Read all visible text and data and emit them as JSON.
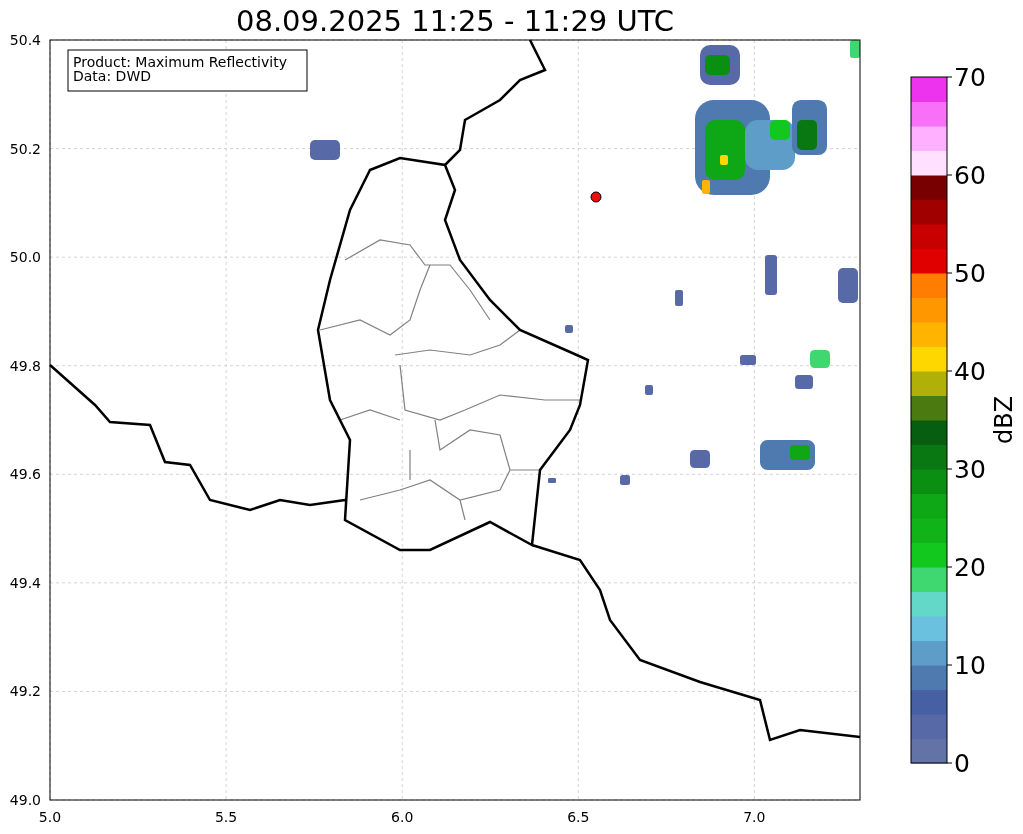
{
  "title": "08.09.2025 11:25 - 11:29 UTC",
  "info_box": [
    "Product: Maximum Reflectivity",
    "Data: DWD"
  ],
  "map": {
    "xticks": [
      "5.0",
      "5.5",
      "6.0",
      "6.5",
      "7.0"
    ],
    "yticks": [
      "50.4",
      "50.2",
      "50.0",
      "49.8",
      "49.6",
      "49.4",
      "49.2",
      "49.0"
    ]
  },
  "colorbar": {
    "label": "dBZ",
    "ticks": [
      "70",
      "60",
      "50",
      "40",
      "30",
      "20",
      "10",
      "0"
    ],
    "bands": [
      {
        "color": "#6373a8"
      },
      {
        "color": "#5769a6"
      },
      {
        "color": "#4760a3"
      },
      {
        "color": "#4e7ab0"
      },
      {
        "color": "#5d9dc8"
      },
      {
        "color": "#69c0df"
      },
      {
        "color": "#64d8c8"
      },
      {
        "color": "#3fd770"
      },
      {
        "color": "#12c81e"
      },
      {
        "color": "#10b418"
      },
      {
        "color": "#0ea715"
      },
      {
        "color": "#0b8f12"
      },
      {
        "color": "#0a7812"
      },
      {
        "color": "#085e10"
      },
      {
        "color": "#4a7a10"
      },
      {
        "color": "#b0b008"
      },
      {
        "color": "#ffd700"
      },
      {
        "color": "#ffb400"
      },
      {
        "color": "#ff9800"
      },
      {
        "color": "#ff7d00"
      },
      {
        "color": "#e00000"
      },
      {
        "color": "#c80000"
      },
      {
        "color": "#a00000"
      },
      {
        "color": "#780000"
      },
      {
        "color": "#ffe0ff"
      },
      {
        "color": "#ffb0ff"
      },
      {
        "color": "#f870f8"
      },
      {
        "color": "#ee33ee"
      }
    ]
  }
}
